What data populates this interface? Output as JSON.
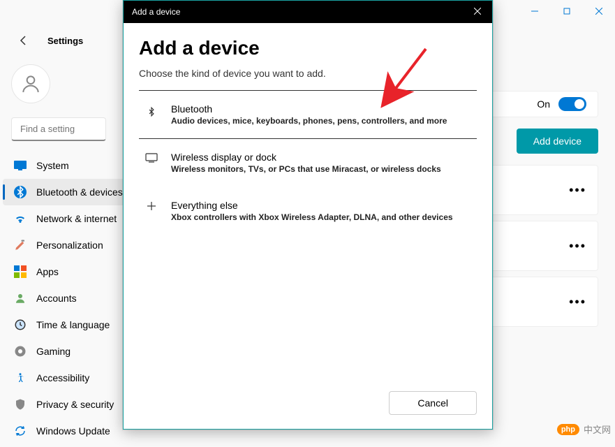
{
  "window": {
    "minimize": "−",
    "maximize": "□",
    "close": "×"
  },
  "header": {
    "back_aria": "Back",
    "title": "Settings"
  },
  "user": {
    "name": ""
  },
  "search": {
    "placeholder": "Find a setting"
  },
  "sidebar": {
    "items": [
      {
        "label": "System",
        "icon": "system"
      },
      {
        "label": "Bluetooth & devices",
        "icon": "bluetooth",
        "active": true
      },
      {
        "label": "Network & internet",
        "icon": "network"
      },
      {
        "label": "Personalization",
        "icon": "personalization"
      },
      {
        "label": "Apps",
        "icon": "apps"
      },
      {
        "label": "Accounts",
        "icon": "accounts"
      },
      {
        "label": "Time & language",
        "icon": "time"
      },
      {
        "label": "Gaming",
        "icon": "gaming"
      },
      {
        "label": "Accessibility",
        "icon": "accessibility"
      },
      {
        "label": "Privacy & security",
        "icon": "privacy"
      },
      {
        "label": "Windows Update",
        "icon": "update"
      }
    ]
  },
  "main": {
    "toggle_label": "On",
    "add_device_label": "Add device",
    "more": "•••"
  },
  "modal": {
    "titlebar": "Add a device",
    "close": "×",
    "heading": "Add a device",
    "subtitle": "Choose the kind of device you want to add.",
    "options": [
      {
        "title": "Bluetooth",
        "desc": "Audio devices, mice, keyboards, phones, pens, controllers, and more"
      },
      {
        "title": "Wireless display or dock",
        "desc": "Wireless monitors, TVs, or PCs that use Miracast, or wireless docks"
      },
      {
        "title": "Everything else",
        "desc": "Xbox controllers with Xbox Wireless Adapter, DLNA, and other devices"
      }
    ],
    "cancel": "Cancel"
  },
  "watermark": {
    "badge": "php",
    "text": "中文网"
  }
}
